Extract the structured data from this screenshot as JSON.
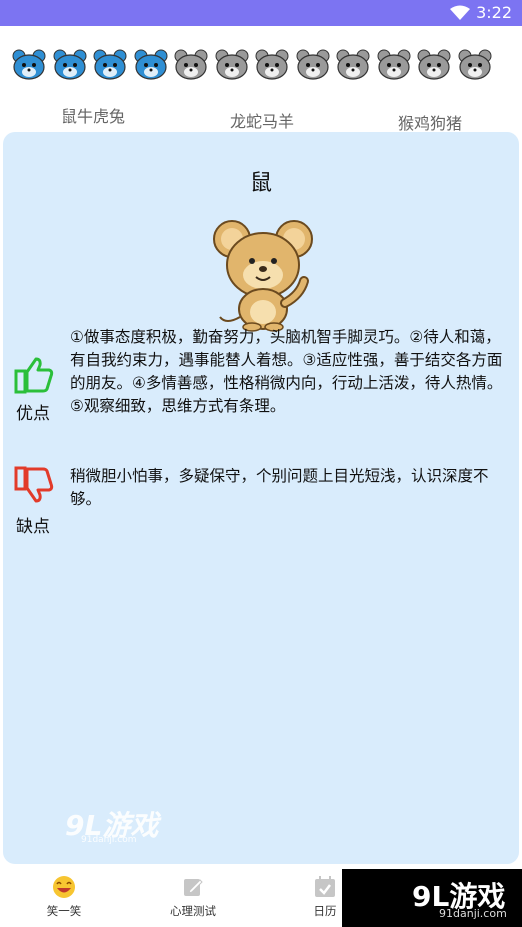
{
  "status_bar": {
    "time": "3:22"
  },
  "zodiac_icons": [
    {
      "name": "rat-face-icon",
      "fill": "#2f8fd4"
    },
    {
      "name": "ox-face-icon",
      "fill": "#2f8fd4"
    },
    {
      "name": "tiger-face-icon",
      "fill": "#2f8fd4"
    },
    {
      "name": "rabbit-face-icon",
      "fill": "#2f8fd4"
    },
    {
      "name": "dragon-face-icon",
      "fill": "#9a9a9a"
    },
    {
      "name": "snake-face-icon",
      "fill": "#9a9a9a"
    },
    {
      "name": "horse-face-icon",
      "fill": "#9a9a9a"
    },
    {
      "name": "goat-face-icon",
      "fill": "#9a9a9a"
    },
    {
      "name": "monkey-face-icon",
      "fill": "#9a9a9a"
    },
    {
      "name": "rooster-face-icon",
      "fill": "#9a9a9a"
    },
    {
      "name": "dog-face-icon",
      "fill": "#9a9a9a"
    },
    {
      "name": "pig-face-icon",
      "fill": "#9a9a9a"
    }
  ],
  "zodiac_groups": [
    "鼠牛虎兔",
    "龙蛇马羊",
    "猴鸡狗猪"
  ],
  "card": {
    "title": "鼠",
    "pros_label": "优点",
    "pros_text": "①做事态度积极，勤奋努力，头脑机智手脚灵巧。②待人和蔼，有自我约束力，遇事能替人着想。③适应性强，善于结交各方面的朋友。④多情善感，性格稍微内向，行动上活泼，待人热情。⑤观察细致，思维方式有条理。",
    "cons_label": "缺点",
    "cons_text": "稍微胆小怕事，多疑保守，个别问题上目光短浅，认识深度不够。"
  },
  "watermark": {
    "logo": "9L游戏",
    "site": "91danji.com"
  },
  "tabbar": {
    "tabs": [
      {
        "label": "笑一笑",
        "icon": "smile-icon"
      },
      {
        "label": "心理测试",
        "icon": "edit-icon"
      },
      {
        "label": "日历",
        "icon": "calendar-icon"
      }
    ]
  },
  "corner_badge": {
    "logo": "9L游戏",
    "site": "91danji.com"
  },
  "colors": {
    "statusbar": "#7c74f2",
    "card_bg": "#d9ecfc",
    "thumb_up": "#2bbf3a",
    "thumb_down": "#e23b2a"
  }
}
